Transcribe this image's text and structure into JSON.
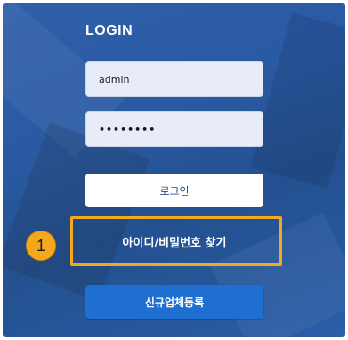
{
  "login": {
    "title": "LOGIN",
    "username_value": "admin",
    "password_value": "••••••••",
    "login_button_label": "로그인",
    "find_account_label": "아이디/비밀번호 찾기",
    "register_button_label": "신규업체등록"
  },
  "annotation": {
    "step_number": "1",
    "highlight_color": "#f4a81d"
  },
  "colors": {
    "background": "#2a5aa3",
    "register_button": "#1f6fd0"
  }
}
